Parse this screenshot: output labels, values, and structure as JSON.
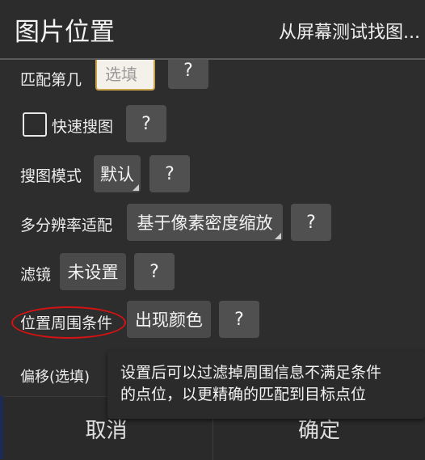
{
  "header": {
    "title": "图片位置",
    "subtitle": "从屏幕测试找图..."
  },
  "rows": {
    "match_nth": {
      "label": "匹配第几",
      "input_placeholder": "选填",
      "help": "?"
    },
    "fast_search": {
      "label": "快速搜图",
      "checked": false,
      "help": "?"
    },
    "search_mode": {
      "label": "搜图模式",
      "value": "默认",
      "help": "?"
    },
    "multi_resolution": {
      "label": "多分辨率适配",
      "value": "基于像素密度缩放",
      "help": "?"
    },
    "filter": {
      "label": "滤镜",
      "value": "未设置",
      "help": "?"
    },
    "surround_condition": {
      "label": "位置周围条件",
      "value": "出现颜色",
      "help": "?"
    },
    "offset": {
      "label": "偏移(选填)"
    }
  },
  "tooltip": {
    "line1": "设置后可以过滤掉周围信息不满足条件",
    "line2": "的点位，以更精确的匹配到目标点位"
  },
  "footer": {
    "cancel": "取消",
    "confirm": "确定"
  },
  "colors": {
    "highlight_ring": "#d61212",
    "input_border": "#c8a24a"
  }
}
